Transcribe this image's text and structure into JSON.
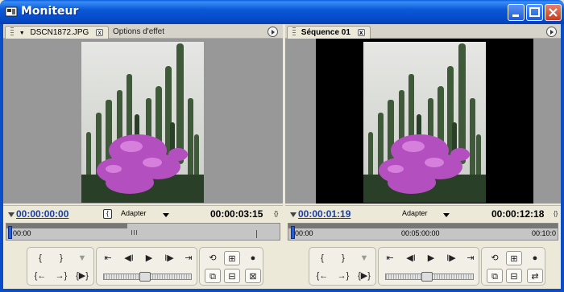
{
  "window": {
    "title": "Moniteur"
  },
  "source": {
    "tabs": [
      {
        "label": "DSCN1872.JPG",
        "close": "x"
      },
      {
        "label": "Options d'effet"
      }
    ],
    "current_tc": "00:00:00:00",
    "fit_label": "Adapter",
    "duration_tc": "00:00:03:15",
    "ruler_labels": [
      "00:00"
    ]
  },
  "program": {
    "tabs": [
      {
        "label": "Séquence 01",
        "close": "x"
      }
    ],
    "current_tc": "00:00:01:19",
    "fit_label": "Adapter",
    "duration_tc": "00:00:12:18",
    "ruler_labels": [
      "00:00",
      "00:05:00:00",
      "00:10:0"
    ]
  },
  "icons": {
    "app": "monitor-app-icon",
    "minimize": "minimize-icon",
    "maximize": "maximize-icon",
    "close": "close-icon",
    "panel_menu": "panel-menu-icon"
  },
  "colors": {
    "titlebar": "#0a58d8",
    "timecode": "#1c3f9e",
    "playhead": "#2a5bd0"
  }
}
